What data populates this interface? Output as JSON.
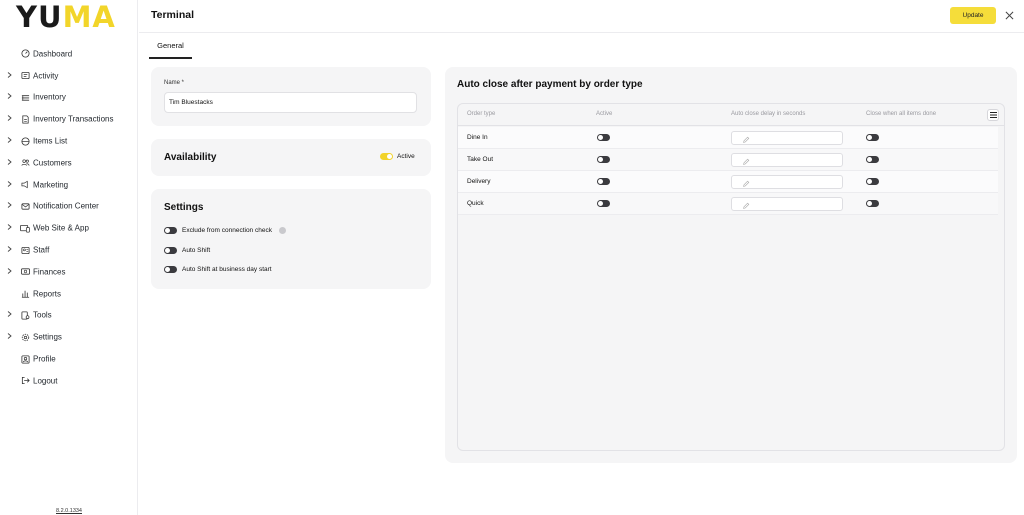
{
  "brand": {
    "logo_part1": "YU",
    "logo_part2": "MA",
    "accent": "#f2d52a"
  },
  "sidebar": {
    "items": [
      {
        "label": "Dashboard",
        "icon": "dashboard-icon",
        "expandable": false
      },
      {
        "label": "Activity",
        "icon": "activity-icon",
        "expandable": true
      },
      {
        "label": "Inventory",
        "icon": "inventory-icon",
        "expandable": true
      },
      {
        "label": "Inventory Transactions",
        "icon": "transactions-icon",
        "expandable": true
      },
      {
        "label": "Items List",
        "icon": "items-icon",
        "expandable": true
      },
      {
        "label": "Customers",
        "icon": "customers-icon",
        "expandable": true
      },
      {
        "label": "Marketing",
        "icon": "marketing-icon",
        "expandable": true
      },
      {
        "label": "Notification Center",
        "icon": "mail-icon",
        "expandable": true
      },
      {
        "label": "Web Site & App",
        "icon": "devices-icon",
        "expandable": true
      },
      {
        "label": "Staff",
        "icon": "staff-icon",
        "expandable": true
      },
      {
        "label": "Finances",
        "icon": "finances-icon",
        "expandable": true
      },
      {
        "label": "Reports",
        "icon": "reports-icon",
        "expandable": false
      },
      {
        "label": "Tools",
        "icon": "tools-icon",
        "expandable": true
      },
      {
        "label": "Settings",
        "icon": "gear-icon",
        "expandable": true
      },
      {
        "label": "Profile",
        "icon": "profile-icon",
        "expandable": false
      },
      {
        "label": "Logout",
        "icon": "logout-icon",
        "expandable": false
      }
    ],
    "version": "8.2.0.1334"
  },
  "header": {
    "title": "Terminal",
    "update_label": "Update"
  },
  "tabs": [
    {
      "label": "General",
      "active": true
    }
  ],
  "name_card": {
    "label": "Name *",
    "value": "Tim Bluestacks"
  },
  "availability": {
    "title": "Availability",
    "toggle_label": "Active",
    "active": true
  },
  "settings": {
    "title": "Settings",
    "options": [
      {
        "label": "Exclude from connection check",
        "enabled": false,
        "info": true
      },
      {
        "label": "Auto Shift",
        "enabled": false,
        "info": false
      },
      {
        "label": "Auto Shift at business day start",
        "enabled": false,
        "info": false
      }
    ]
  },
  "auto_close": {
    "title": "Auto close after payment by order type",
    "columns": [
      "Order type",
      "Active",
      "Auto close delay in seconds",
      "Close when all items done"
    ],
    "rows": [
      {
        "type": "Dine In",
        "active": false,
        "delay": "",
        "close_when_done": false
      },
      {
        "type": "Take Out",
        "active": false,
        "delay": "",
        "close_when_done": false
      },
      {
        "type": "Delivery",
        "active": false,
        "delay": "",
        "close_when_done": false
      },
      {
        "type": "Quick",
        "active": false,
        "delay": "",
        "close_when_done": false
      }
    ]
  }
}
